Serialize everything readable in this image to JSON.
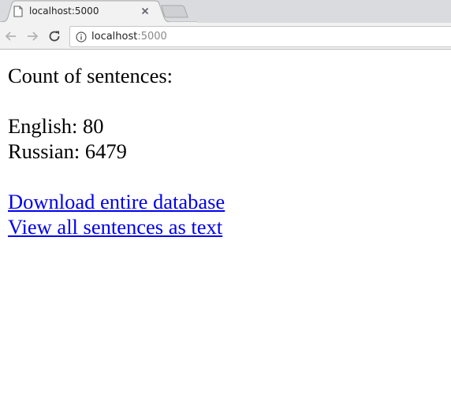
{
  "browser": {
    "tab": {
      "title": "localhost:5000"
    },
    "address_bar": {
      "host": "localhost",
      "port": ":5000"
    }
  },
  "page": {
    "heading": "Count of sentences:",
    "counts": [
      {
        "label": "English:",
        "value": "80"
      },
      {
        "label": "Russian:",
        "value": "6479"
      }
    ],
    "links": [
      {
        "text": "Download entire database"
      },
      {
        "text": "View all sentences as text"
      }
    ]
  }
}
